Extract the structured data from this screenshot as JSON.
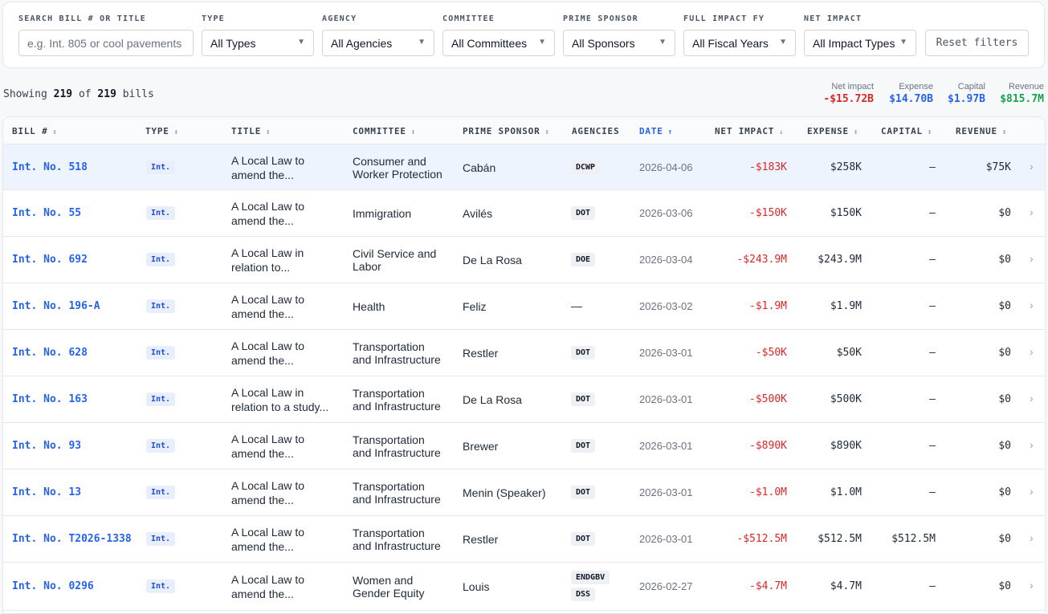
{
  "filters": {
    "search": {
      "label": "SEARCH BILL # OR TITLE",
      "placeholder": "e.g. Int. 805 or cool pavements",
      "value": ""
    },
    "type": {
      "label": "TYPE",
      "value": "All Types"
    },
    "agency": {
      "label": "AGENCY",
      "value": "All Agencies"
    },
    "committee": {
      "label": "COMMITTEE",
      "value": "All Committees"
    },
    "sponsor": {
      "label": "PRIME SPONSOR",
      "value": "All Sponsors"
    },
    "fiscal_year": {
      "label": "FULL IMPACT FY",
      "value": "All Fiscal Years"
    },
    "net_impact": {
      "label": "NET IMPACT",
      "value": "All Impact Types"
    },
    "reset_label": "Reset filters",
    "caret": "▼"
  },
  "summary": {
    "prefix": "Showing",
    "shown": "219",
    "of": "of",
    "total": "219",
    "suffix": "bills"
  },
  "stats": [
    {
      "label": "Net impact",
      "value": "-$15.72B",
      "color": "#dc2626"
    },
    {
      "label": "Expense",
      "value": "$14.70B",
      "color": "#2563eb"
    },
    {
      "label": "Capital",
      "value": "$1.97B",
      "color": "#2563eb"
    },
    {
      "label": "Revenue",
      "value": "$815.7M",
      "color": "#16a34a"
    }
  ],
  "columns": {
    "bill": "BILL #",
    "type": "TYPE",
    "title": "TITLE",
    "committee": "COMMITTEE",
    "sponsor": "PRIME SPONSOR",
    "agencies": "AGENCIES",
    "date": "DATE",
    "net": "NET IMPACT",
    "expense": "EXPENSE",
    "capital": "CAPITAL",
    "revenue": "REVENUE",
    "sort_icon": "↕",
    "sort_asc_icon": "↑",
    "sort_desc_icon": "↓"
  },
  "chevron": "›",
  "rows": [
    {
      "bill": "Int. No. 518",
      "type": "Int.",
      "title1": "A Local Law to",
      "title2": "amend the...",
      "comm1": "Consumer and",
      "comm2": "Worker Protection",
      "sponsor": "Cabán",
      "agencies": [
        "DCWP"
      ],
      "date": "2026-04-06",
      "net": "-$183K",
      "expense": "$258K",
      "capital": "–",
      "revenue": "$75K",
      "selected": true
    },
    {
      "bill": "Int. No. 55",
      "type": "Int.",
      "title1": "A Local Law to",
      "title2": "amend the...",
      "comm1": "Immigration",
      "comm2": "",
      "sponsor": "Avilés",
      "agencies": [
        "DOT"
      ],
      "date": "2026-03-06",
      "net": "-$150K",
      "expense": "$150K",
      "capital": "–",
      "revenue": "$0"
    },
    {
      "bill": "Int. No. 692",
      "type": "Int.",
      "title1": "A Local Law in",
      "title2": "relation to...",
      "comm1": "Civil Service and",
      "comm2": "Labor",
      "sponsor": "De La Rosa",
      "agencies": [
        "DOE"
      ],
      "date": "2026-03-04",
      "net": "-$243.9M",
      "expense": "$243.9M",
      "capital": "–",
      "revenue": "$0"
    },
    {
      "bill": "Int. No. 196-A",
      "type": "Int.",
      "title1": "A Local Law to",
      "title2": "amend the...",
      "comm1": "Health",
      "comm2": "",
      "sponsor": "Feliz",
      "agencies": [],
      "agencies_empty": "—",
      "date": "2026-03-02",
      "net": "-$1.9M",
      "expense": "$1.9M",
      "capital": "–",
      "revenue": "$0"
    },
    {
      "bill": "Int. No. 628",
      "type": "Int.",
      "title1": "A Local Law to",
      "title2": "amend the...",
      "comm1": "Transportation",
      "comm2": "and Infrastructure",
      "sponsor": "Restler",
      "agencies": [
        "DOT"
      ],
      "date": "2026-03-01",
      "net": "-$50K",
      "expense": "$50K",
      "capital": "–",
      "revenue": "$0"
    },
    {
      "bill": "Int. No. 163",
      "type": "Int.",
      "title1": "A Local Law in",
      "title2": "relation to a study...",
      "comm1": "Transportation",
      "comm2": "and Infrastructure",
      "sponsor": "De La Rosa",
      "agencies": [
        "DOT"
      ],
      "date": "2026-03-01",
      "net": "-$500K",
      "expense": "$500K",
      "capital": "–",
      "revenue": "$0"
    },
    {
      "bill": "Int. No. 93",
      "type": "Int.",
      "title1": "A Local Law to",
      "title2": "amend the...",
      "comm1": "Transportation",
      "comm2": "and Infrastructure",
      "sponsor": "Brewer",
      "agencies": [
        "DOT"
      ],
      "date": "2026-03-01",
      "net": "-$890K",
      "expense": "$890K",
      "capital": "–",
      "revenue": "$0"
    },
    {
      "bill": "Int. No. 13",
      "type": "Int.",
      "title1": "A Local Law to",
      "title2": "amend the...",
      "comm1": "Transportation",
      "comm2": "and Infrastructure",
      "sponsor": "Menin (Speaker)",
      "agencies": [
        "DOT"
      ],
      "date": "2026-03-01",
      "net": "-$1.0M",
      "expense": "$1.0M",
      "capital": "–",
      "revenue": "$0"
    },
    {
      "bill": "Int. No. T2026-1338",
      "type": "Int.",
      "title1": "A Local Law to",
      "title2": "amend the...",
      "comm1": "Transportation",
      "comm2": "and Infrastructure",
      "sponsor": "Restler",
      "agencies": [
        "DOT"
      ],
      "date": "2026-03-01",
      "net": "-$512.5M",
      "expense": "$512.5M",
      "capital": "$512.5M",
      "revenue": "$0"
    },
    {
      "bill": "Int. No. 0296",
      "type": "Int.",
      "title1": "A Local Law to",
      "title2": "amend the...",
      "comm1": "Women and",
      "comm2": "Gender Equity",
      "sponsor": "Louis",
      "agencies": [
        "ENDGBV",
        "DSS"
      ],
      "date": "2026-02-27",
      "net": "-$4.7M",
      "expense": "$4.7M",
      "capital": "–",
      "revenue": "$0"
    }
  ]
}
